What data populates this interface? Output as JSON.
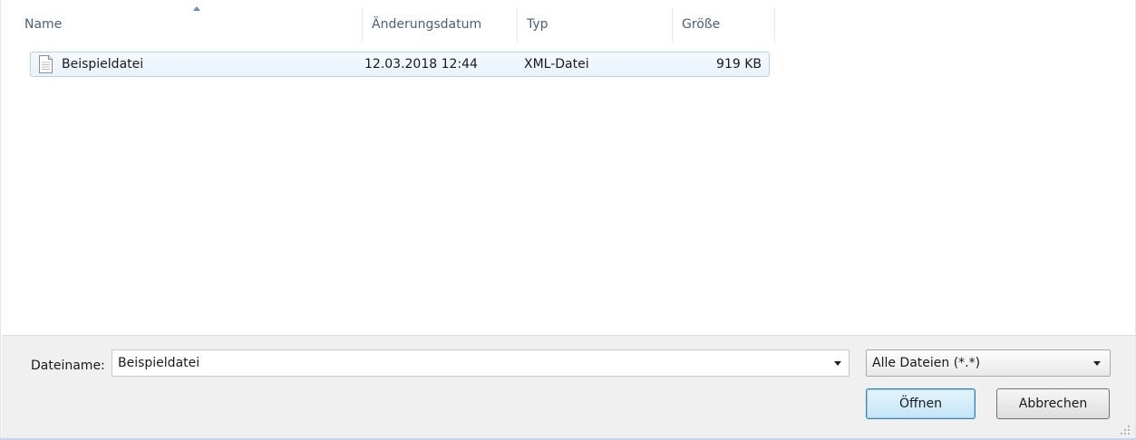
{
  "columns": {
    "name": "Name",
    "modified": "Änderungsdatum",
    "type": "Typ",
    "size": "Größe"
  },
  "files": [
    {
      "name": "Beispieldatei",
      "modified": "12.03.2018 12:44",
      "type": "XML-Datei",
      "size": "919 KB",
      "icon": "document-icon"
    }
  ],
  "filename": {
    "label": "Dateiname:",
    "value": "Beispieldatei"
  },
  "filter": {
    "selected": "Alle Dateien (*.*)"
  },
  "buttons": {
    "open": "Öffnen",
    "cancel": "Abbrechen"
  },
  "colors": {
    "selection_border": "#b8d1ee",
    "header_text": "#4c607a",
    "default_button_border": "#3c7fb1"
  }
}
